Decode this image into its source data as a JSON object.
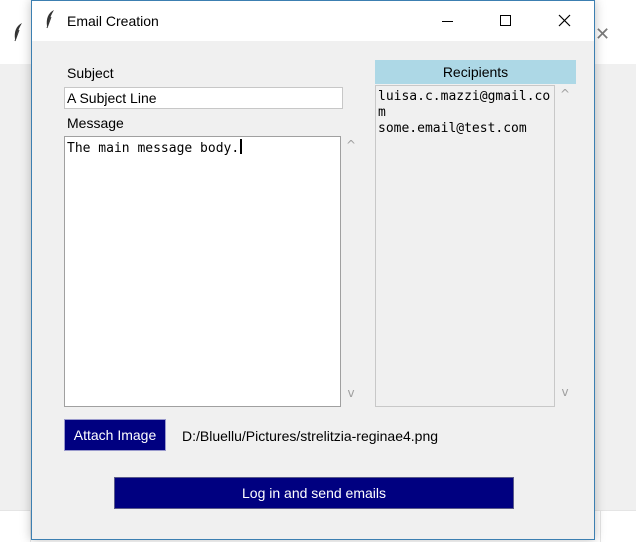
{
  "window": {
    "title": "Email Creation"
  },
  "subject": {
    "label": "Subject",
    "value": "A Subject Line"
  },
  "message": {
    "label": "Message",
    "value": "The main message body."
  },
  "recipients": {
    "header": "Recipients",
    "items": [
      "luisa.c.mazzi@gmail.com",
      "some.email@test.com"
    ]
  },
  "attach": {
    "button_label": "Attach Image",
    "path": "D:/Bluellu/Pictures/strelitzia-reginae4.png"
  },
  "send": {
    "button_label": "Log in and send emails"
  },
  "icons": {
    "app": "feather-icon",
    "close_glyph": "✕",
    "scroll_up": "^",
    "scroll_down": "v"
  },
  "colors": {
    "button_bg": "#000080",
    "recipients_header_bg": "#add8e6",
    "window_bg": "#f0f0f0"
  }
}
